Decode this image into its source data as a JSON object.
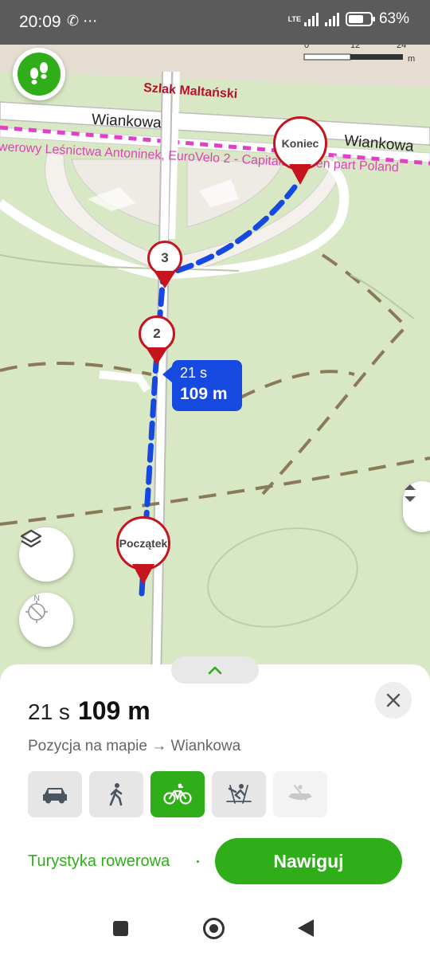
{
  "status": {
    "time": "20:09",
    "left_icons": "✆ ⋯",
    "network": "LTE",
    "battery": "63%"
  },
  "scale": {
    "tick0": "0",
    "tick1": "12",
    "tick2": "24",
    "unit": "m"
  },
  "map": {
    "trail_name": "Szlak Maltański",
    "street_left": "Wiankowa",
    "street_right": "Wiankowa",
    "trail_label": "werowy Leśnictwa Antoninek, EuroVelo 2 - Capitals, Green part Poland"
  },
  "markers": {
    "end": "Koniec",
    "waypoint3": "3",
    "waypoint2": "2",
    "start": "Początek"
  },
  "callout": {
    "time": "21 s",
    "distance": "109 m"
  },
  "sheet": {
    "time": "21 s",
    "distance": "109 m",
    "route_desc": "Pozycja na mapie → Wiankowa",
    "modes": [
      {
        "icon": "car-icon",
        "state": "normal"
      },
      {
        "icon": "walk-icon",
        "state": "normal"
      },
      {
        "icon": "bicycle-icon",
        "state": "active"
      },
      {
        "icon": "ski-icon",
        "state": "normal"
      },
      {
        "icon": "boat-icon",
        "state": "disabled"
      }
    ],
    "profile": "Turystyka rowerowa",
    "navigate_label": "Nawiguj"
  },
  "colors": {
    "accent": "#2fae1a",
    "route": "#1549e0",
    "marker": "#c5141e",
    "trail": "#d946b5",
    "map_bg": "#d8e8c4"
  }
}
